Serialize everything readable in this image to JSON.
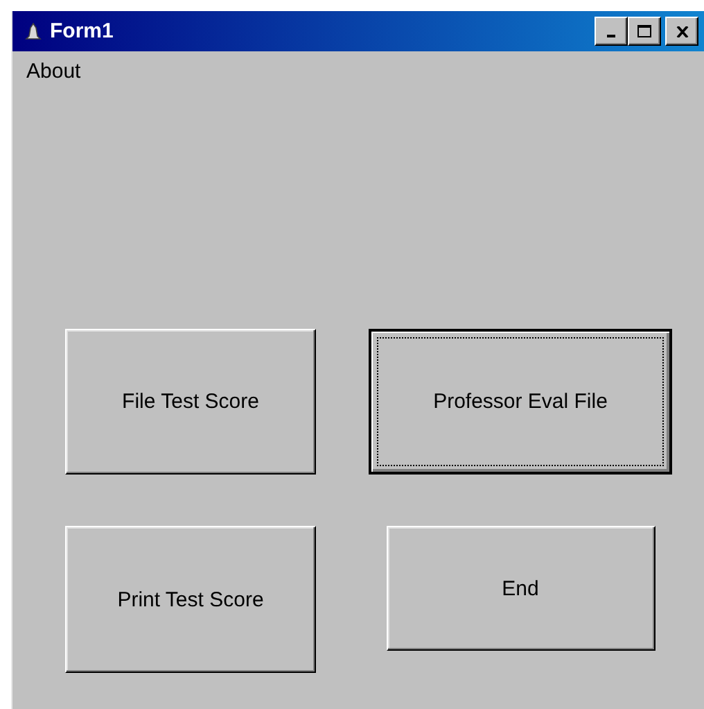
{
  "window": {
    "title": "Form1"
  },
  "menu": [
    {
      "label": "About"
    }
  ],
  "buttons": [
    {
      "label": "File Test Score",
      "focused": false
    },
    {
      "label": "Professor Eval File",
      "focused": true
    },
    {
      "label": "Print Test Score",
      "focused": false
    },
    {
      "label": "End",
      "focused": false
    }
  ]
}
